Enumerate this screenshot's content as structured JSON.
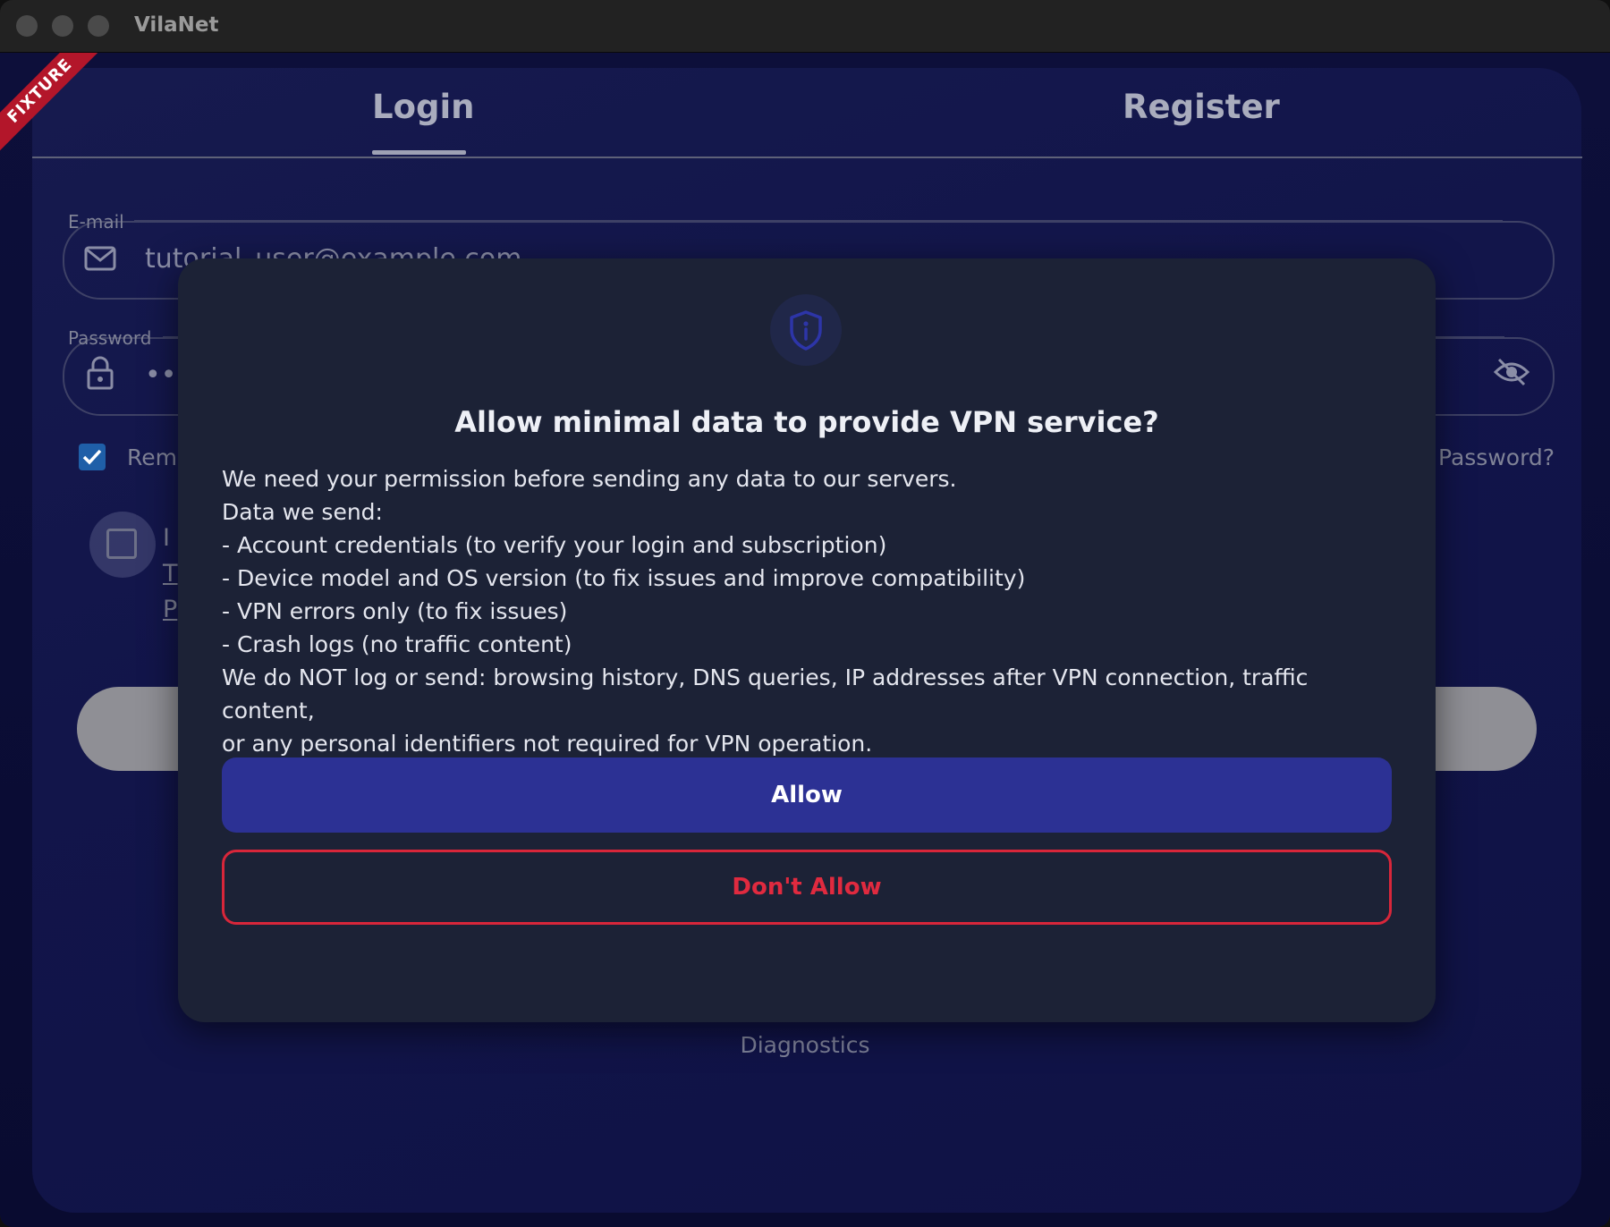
{
  "window": {
    "title": "VilaNet"
  },
  "ribbon": {
    "label": "FIXTURE"
  },
  "tabs": [
    {
      "label": "Login",
      "active": true
    },
    {
      "label": "Register",
      "active": false
    }
  ],
  "form": {
    "email": {
      "label": "E-mail",
      "value": "tutorial_user@example.com",
      "icon": "mail-icon"
    },
    "password": {
      "label": "Password",
      "value": "•••",
      "icon": "lock-icon",
      "toggle_icon": "eye-off-icon"
    },
    "remember": {
      "label": "Reme",
      "checked": true
    },
    "forgot": {
      "label": "Password?"
    },
    "terms": {
      "lines": [
        "I",
        "T",
        "P"
      ],
      "checked": false
    }
  },
  "footer": {
    "diagnostics": "Diagnostics"
  },
  "dialog": {
    "icon": "shield-info-icon",
    "title": "Allow minimal data to provide VPN service?",
    "body": [
      "We need your permission before sending any data to our servers.",
      "Data we send:",
      "- Account credentials (to verify your login and subscription)",
      "- Device model and OS version (to fix issues and improve compatibility)",
      "- VPN errors only (to fix issues)",
      "- Crash logs (no traffic content)",
      "We do NOT log or send: browsing history, DNS queries, IP addresses after VPN connection, traffic content,",
      "or any personal identifiers not required for VPN operation."
    ],
    "allow_label": "Allow",
    "deny_label": "Don't Allow"
  },
  "colors": {
    "accent": "#2c3194",
    "danger": "#e02a3f",
    "dialog_bg": "#1c2236",
    "checkbox": "#1f5fa8"
  }
}
